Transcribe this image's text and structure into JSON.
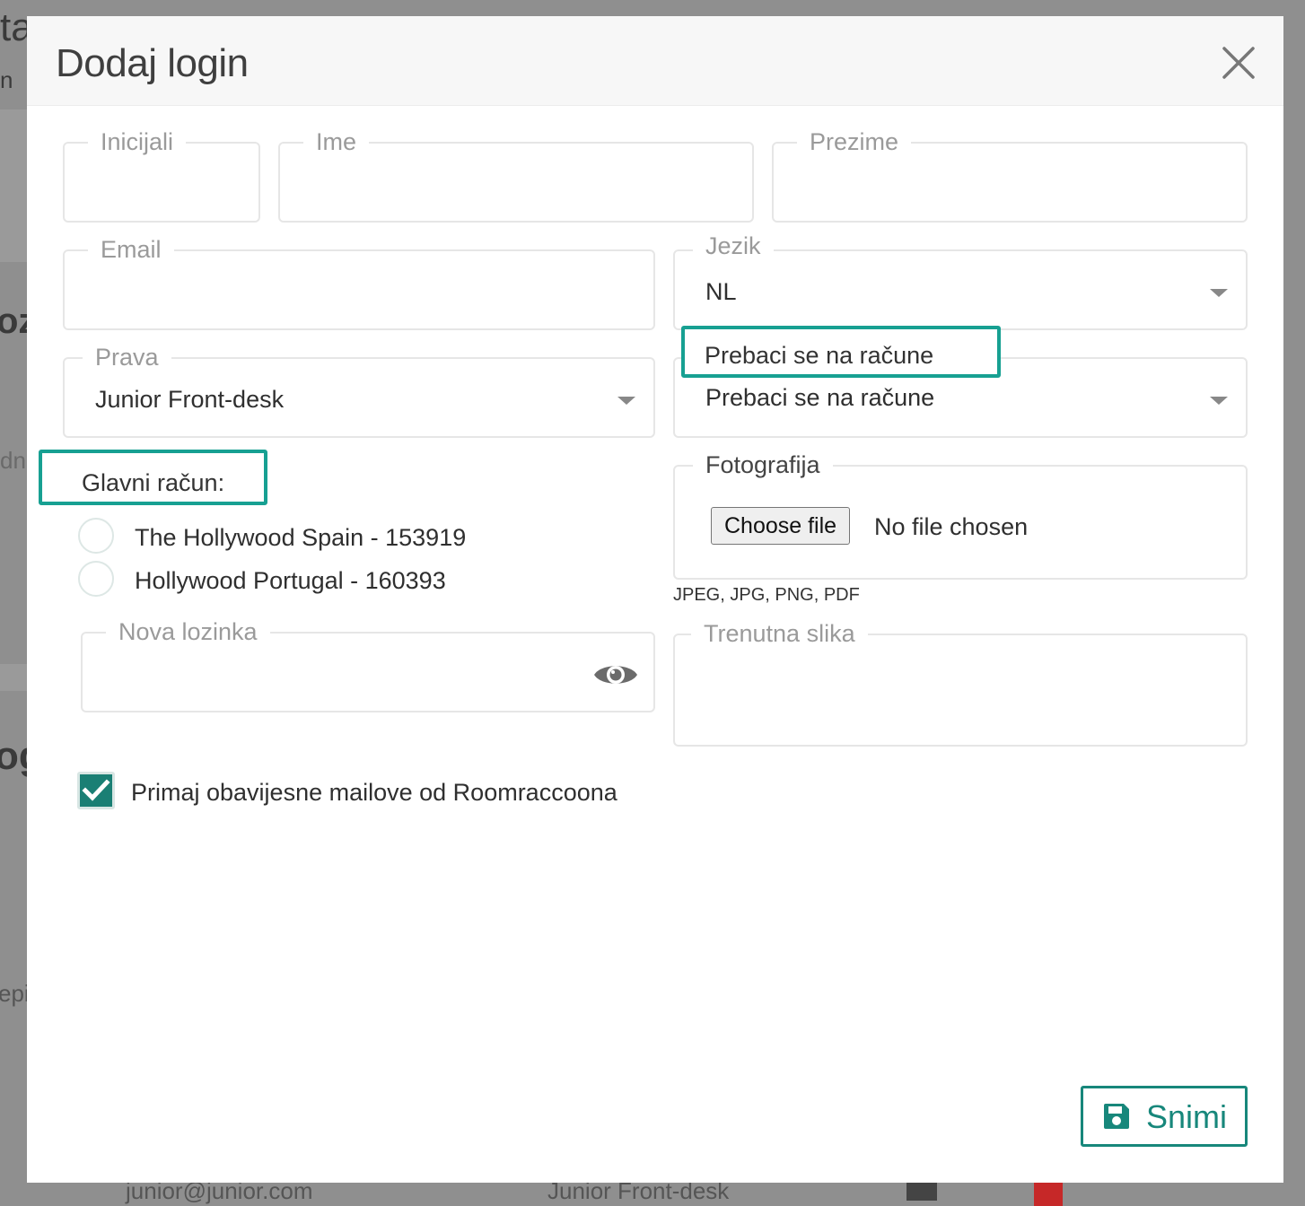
{
  "background": {
    "fragments": [
      "ta",
      "n",
      "oz",
      "dn",
      "og",
      "epi"
    ],
    "footer_email": "junior@junior.com",
    "footer_role": "Junior Front-desk"
  },
  "modal": {
    "title": "Dodaj login",
    "close_icon": "close-icon"
  },
  "fields": {
    "initials": {
      "label": "Inicijali",
      "value": ""
    },
    "first_name": {
      "label": "Ime",
      "value": ""
    },
    "last_name": {
      "label": "Prezime",
      "value": ""
    },
    "email": {
      "label": "Email",
      "value": ""
    },
    "language": {
      "label": "Jezik",
      "value": "NL"
    },
    "rights": {
      "label": "Prava",
      "value": "Junior Front-desk"
    },
    "switch_accounts": {
      "label": "Prebaci se na račune",
      "value": "Prebaci se na račune"
    },
    "main_account": {
      "label": "Glavni račun:",
      "options": [
        "The Hollywood Spain - 153919",
        "Hollywood Portugal - 160393"
      ]
    },
    "photo": {
      "label": "Fotografija",
      "button": "Choose file",
      "status": "No file chosen",
      "hint": "JPEG, JPG, PNG, PDF"
    },
    "new_password": {
      "label": "Nova lozinka",
      "value": ""
    },
    "current_image": {
      "label": "Trenutna slika"
    },
    "notifications": {
      "label": "Primaj obavijesne mailove od Roomraccoona",
      "checked": true
    }
  },
  "actions": {
    "save_label": "Snimi"
  },
  "colors": {
    "accent": "#17877b",
    "highlight": "#17a092",
    "checkbox": "#1a7f74"
  }
}
